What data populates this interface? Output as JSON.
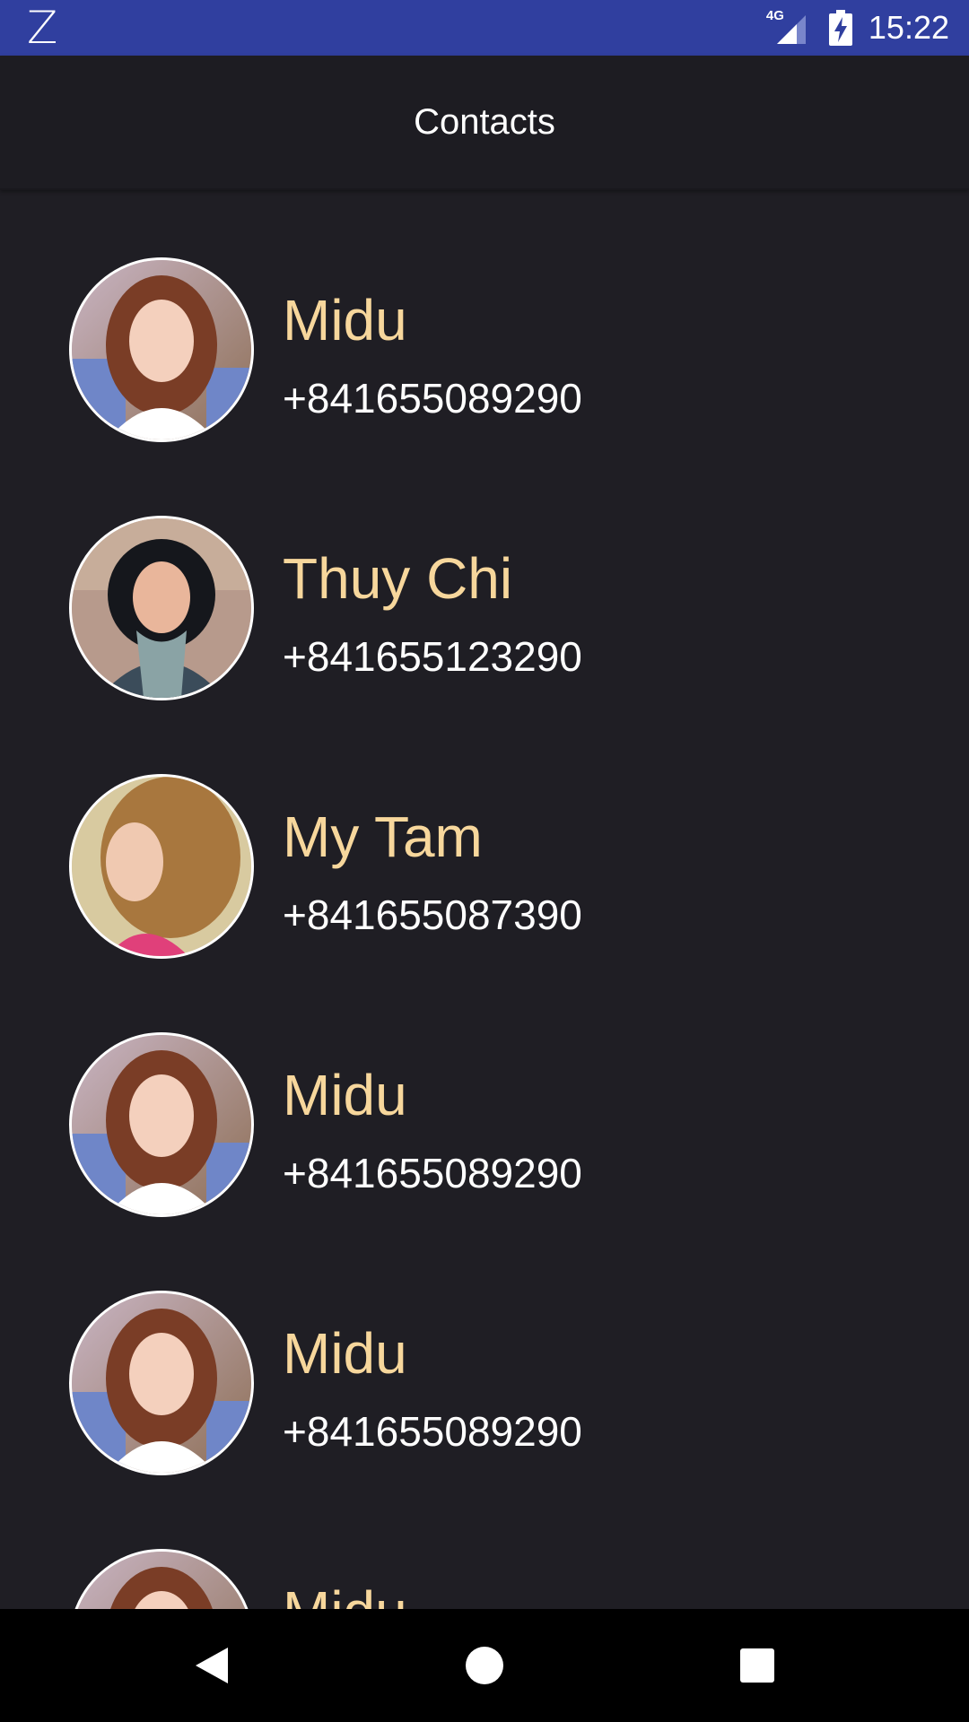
{
  "status_bar": {
    "app_icon": "Z",
    "network": "4G",
    "time": "15:22",
    "icons": [
      "signal-icon",
      "battery-charging-icon"
    ]
  },
  "app_bar": {
    "title": "Contacts"
  },
  "contacts": [
    {
      "name": "Midu",
      "phone": "+841655089290"
    },
    {
      "name": "Thuy Chi",
      "phone": "+841655123290"
    },
    {
      "name": "My Tam",
      "phone": "+841655087390"
    },
    {
      "name": "Midu",
      "phone": "+841655089290"
    },
    {
      "name": "Midu",
      "phone": "+841655089290"
    },
    {
      "name": "Midu",
      "phone": ""
    }
  ],
  "nav_bar": {
    "buttons": [
      "back-icon",
      "home-icon",
      "recents-icon"
    ]
  },
  "colors": {
    "status_bar": "#303f9f",
    "background": "#1f1e24",
    "contact_name": "#f7d79c",
    "phone_text": "#ffffff"
  }
}
